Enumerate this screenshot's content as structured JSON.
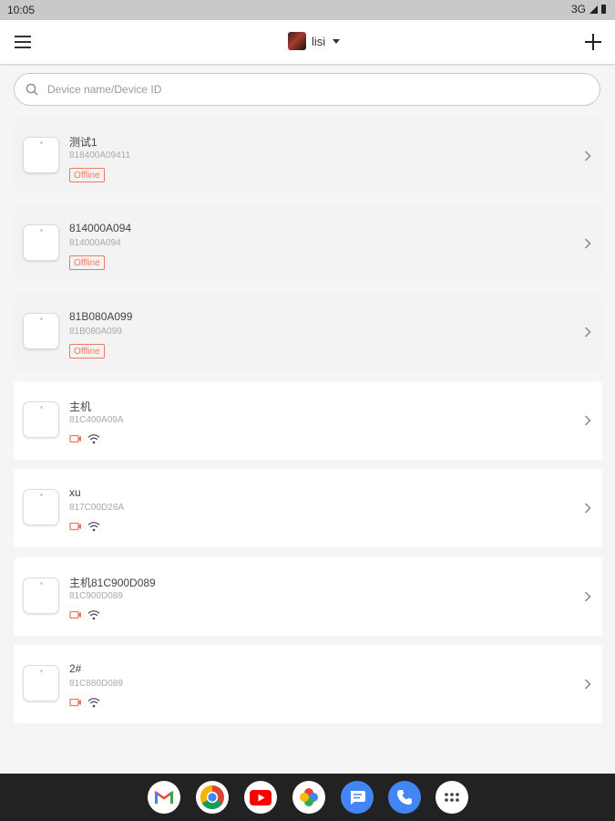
{
  "status_bar": {
    "time": "10:05",
    "network": "3G"
  },
  "app_bar": {
    "account_name": "lisi"
  },
  "search": {
    "placeholder": "Device name/Device ID",
    "value": ""
  },
  "devices": [
    {
      "name": "测试1",
      "id": "818400A09411",
      "status": "Offline"
    },
    {
      "name": "814000A094",
      "id": "814000A094",
      "status": "Offline"
    },
    {
      "name": "81B080A099",
      "id": "81B080A099",
      "status": "Offline"
    },
    {
      "name": "主机",
      "id": "81C400A09A"
    },
    {
      "name": "xu",
      "id": "817C00D28A"
    },
    {
      "name": "主机81C900D089",
      "id": "81C900D089"
    },
    {
      "name": "2#",
      "id": "81C880D089"
    }
  ],
  "colors": {
    "accent": "#ee7a5e",
    "background": "#f5f5f5",
    "nav_bar": "#222222"
  },
  "dock": [
    "gmail-icon",
    "chrome-icon",
    "youtube-icon",
    "photos-icon",
    "messages-icon",
    "phone-icon",
    "app-drawer-icon"
  ]
}
